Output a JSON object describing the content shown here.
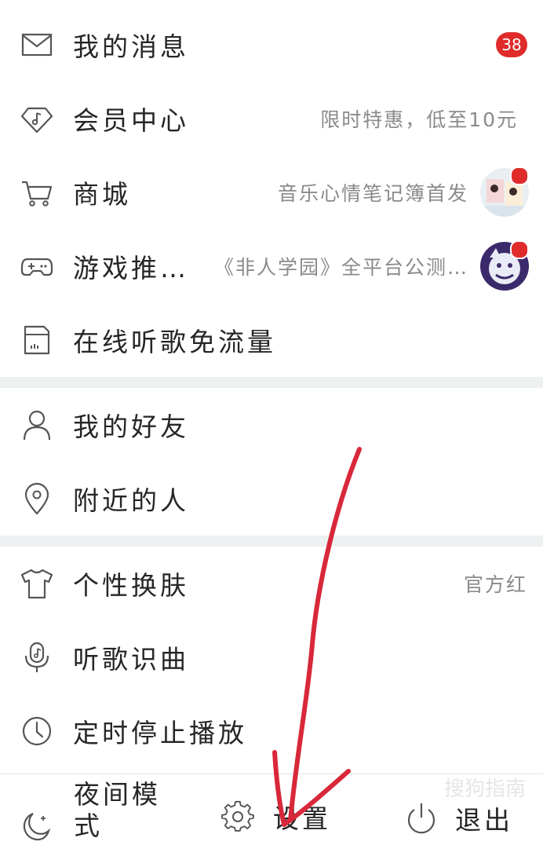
{
  "menu": {
    "messages": {
      "label": "我的消息",
      "badge": "38"
    },
    "vip": {
      "label": "会员中心",
      "hint": "限时特惠，低至10元"
    },
    "mall": {
      "label": "商城",
      "hint": "音乐心情笔记簿首发"
    },
    "games": {
      "label": "游戏推…",
      "hint": "《非人学园》全平台公测…"
    },
    "free_flow": {
      "label": "在线听歌免流量"
    },
    "friends": {
      "label": "我的好友"
    },
    "nearby": {
      "label": "附近的人"
    },
    "skin": {
      "label": "个性换肤",
      "hint": "官方红"
    },
    "recognize": {
      "label": "听歌识曲"
    },
    "timer": {
      "label": "定时停止播放"
    }
  },
  "bottom_bar": {
    "night_mode": "夜间模式",
    "settings": "设置",
    "logout": "退出"
  },
  "watermark": "搜狗指南",
  "colors": {
    "accent": "#e02b2b",
    "divider": "#eef1f1",
    "annotation_arrow": "#d8283a"
  }
}
